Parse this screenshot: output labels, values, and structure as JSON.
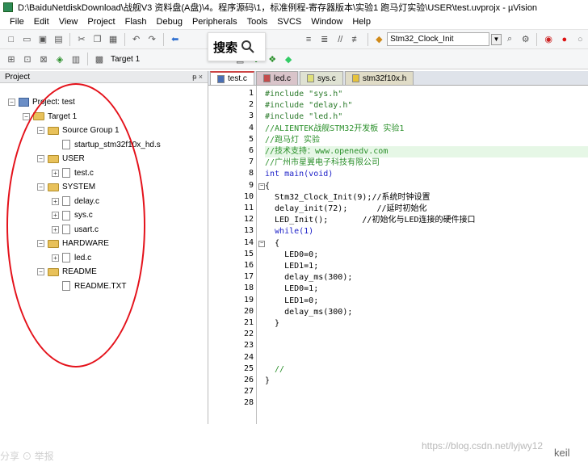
{
  "window": {
    "title": "D:\\BaiduNetdiskDownload\\战舰V3 资料盘(A盘)\\4。程序源码\\1，标准例程-寄存器版本\\实验1 跑马灯实验\\USER\\test.uvprojx - µVision"
  },
  "menu": [
    "File",
    "Edit",
    "View",
    "Project",
    "Flash",
    "Debug",
    "Peripherals",
    "Tools",
    "SVCS",
    "Window",
    "Help"
  ],
  "toolbar": {
    "target_combo": "Stm32_Clock_Init",
    "target_name": "Target 1"
  },
  "search_overlay": {
    "label": "搜索"
  },
  "project_panel": {
    "header": "Project",
    "pin_glyph": " ᵽ ×",
    "tree": [
      {
        "label": "Project: test",
        "kind": "project",
        "depth": 0,
        "expander": "−"
      },
      {
        "label": "Target 1",
        "kind": "target",
        "depth": 1,
        "expander": "−"
      },
      {
        "label": "Source Group 1",
        "kind": "folder",
        "depth": 2,
        "expander": "−"
      },
      {
        "label": "startup_stm32f10x_hd.s",
        "kind": "file",
        "depth": 3,
        "expander": ""
      },
      {
        "label": "USER",
        "kind": "folder",
        "depth": 2,
        "expander": "−"
      },
      {
        "label": "test.c",
        "kind": "file",
        "depth": 3,
        "expander": "+"
      },
      {
        "label": "SYSTEM",
        "kind": "folder",
        "depth": 2,
        "expander": "−"
      },
      {
        "label": "delay.c",
        "kind": "file",
        "depth": 3,
        "expander": "+"
      },
      {
        "label": "sys.c",
        "kind": "file",
        "depth": 3,
        "expander": "+"
      },
      {
        "label": "usart.c",
        "kind": "file",
        "depth": 3,
        "expander": "+"
      },
      {
        "label": "HARDWARE",
        "kind": "folder",
        "depth": 2,
        "expander": "−"
      },
      {
        "label": "led.c",
        "kind": "file",
        "depth": 3,
        "expander": "+"
      },
      {
        "label": "README",
        "kind": "folder",
        "depth": 2,
        "expander": "−"
      },
      {
        "label": "README.TXT",
        "kind": "file",
        "depth": 3,
        "expander": ""
      }
    ]
  },
  "editor": {
    "tabs": [
      {
        "label": "test.c",
        "active": true,
        "color": "#4a6fb5"
      },
      {
        "label": "led.c",
        "active": false,
        "color": "#c44c4c"
      },
      {
        "label": "sys.c",
        "active": false,
        "color": "#dfe07a"
      },
      {
        "label": "stm32f10x.h",
        "active": false,
        "color": "#e6c23a"
      }
    ],
    "lines": [
      {
        "n": "1",
        "text": "#include \"sys.h\"",
        "cls": "c-pre"
      },
      {
        "n": "2",
        "text": "#include \"delay.h\"",
        "cls": "c-pre"
      },
      {
        "n": "3",
        "text": "#include \"led.h\"",
        "cls": "c-pre"
      },
      {
        "n": "4",
        "text": "//ALIENTEK战舰STM32开发板 实验1",
        "cls": "c-cmt"
      },
      {
        "n": "5",
        "text": "//跑马灯 实验",
        "cls": "c-cmt"
      },
      {
        "n": "6",
        "text": "//技术支持：www.openedv.com",
        "cls": "c-cmt"
      },
      {
        "n": "7",
        "text": "//广州市星翼电子科技有限公司",
        "cls": "c-cmt"
      },
      {
        "n": "8",
        "text": "int main(void)",
        "cls": "c-kw"
      },
      {
        "n": "9",
        "text": "{",
        "cls": "c-plain"
      },
      {
        "n": "10",
        "text": "  Stm32_Clock_Init(9);//系统时钟设置",
        "cls": "c-plain"
      },
      {
        "n": "11",
        "text": "  delay_init(72);      //延时初始化",
        "cls": "c-plain"
      },
      {
        "n": "12",
        "text": "  LED_Init();       //初始化与LED连接的硬件接口",
        "cls": "c-plain"
      },
      {
        "n": "13",
        "text": "  while(1)",
        "cls": "c-kw"
      },
      {
        "n": "14",
        "text": "  {",
        "cls": "c-plain"
      },
      {
        "n": "15",
        "text": "    LED0=0;",
        "cls": "c-plain"
      },
      {
        "n": "16",
        "text": "    LED1=1;",
        "cls": "c-plain"
      },
      {
        "n": "17",
        "text": "    delay_ms(300);",
        "cls": "c-plain"
      },
      {
        "n": "18",
        "text": "    LED0=1;",
        "cls": "c-plain"
      },
      {
        "n": "19",
        "text": "    LED1=0;",
        "cls": "c-plain"
      },
      {
        "n": "20",
        "text": "    delay_ms(300);",
        "cls": "c-plain"
      },
      {
        "n": "21",
        "text": "  }",
        "cls": "c-plain"
      },
      {
        "n": "22",
        "text": "",
        "cls": "c-plain"
      },
      {
        "n": "23",
        "text": "",
        "cls": "c-plain"
      },
      {
        "n": "24",
        "text": "",
        "cls": "c-plain"
      },
      {
        "n": "25",
        "text": "  //",
        "cls": "c-cmt"
      },
      {
        "n": "26",
        "text": "}",
        "cls": "c-plain"
      },
      {
        "n": "27",
        "text": "",
        "cls": "c-plain"
      },
      {
        "n": "28",
        "text": "",
        "cls": "c-plain"
      }
    ],
    "fold_markers": [
      "9",
      "14"
    ]
  },
  "footer": {
    "watermark": "https://blog.csdn.net/lyjwy12",
    "keil_tag": "keil",
    "faint_left": "分享 ⊙ 举报"
  }
}
